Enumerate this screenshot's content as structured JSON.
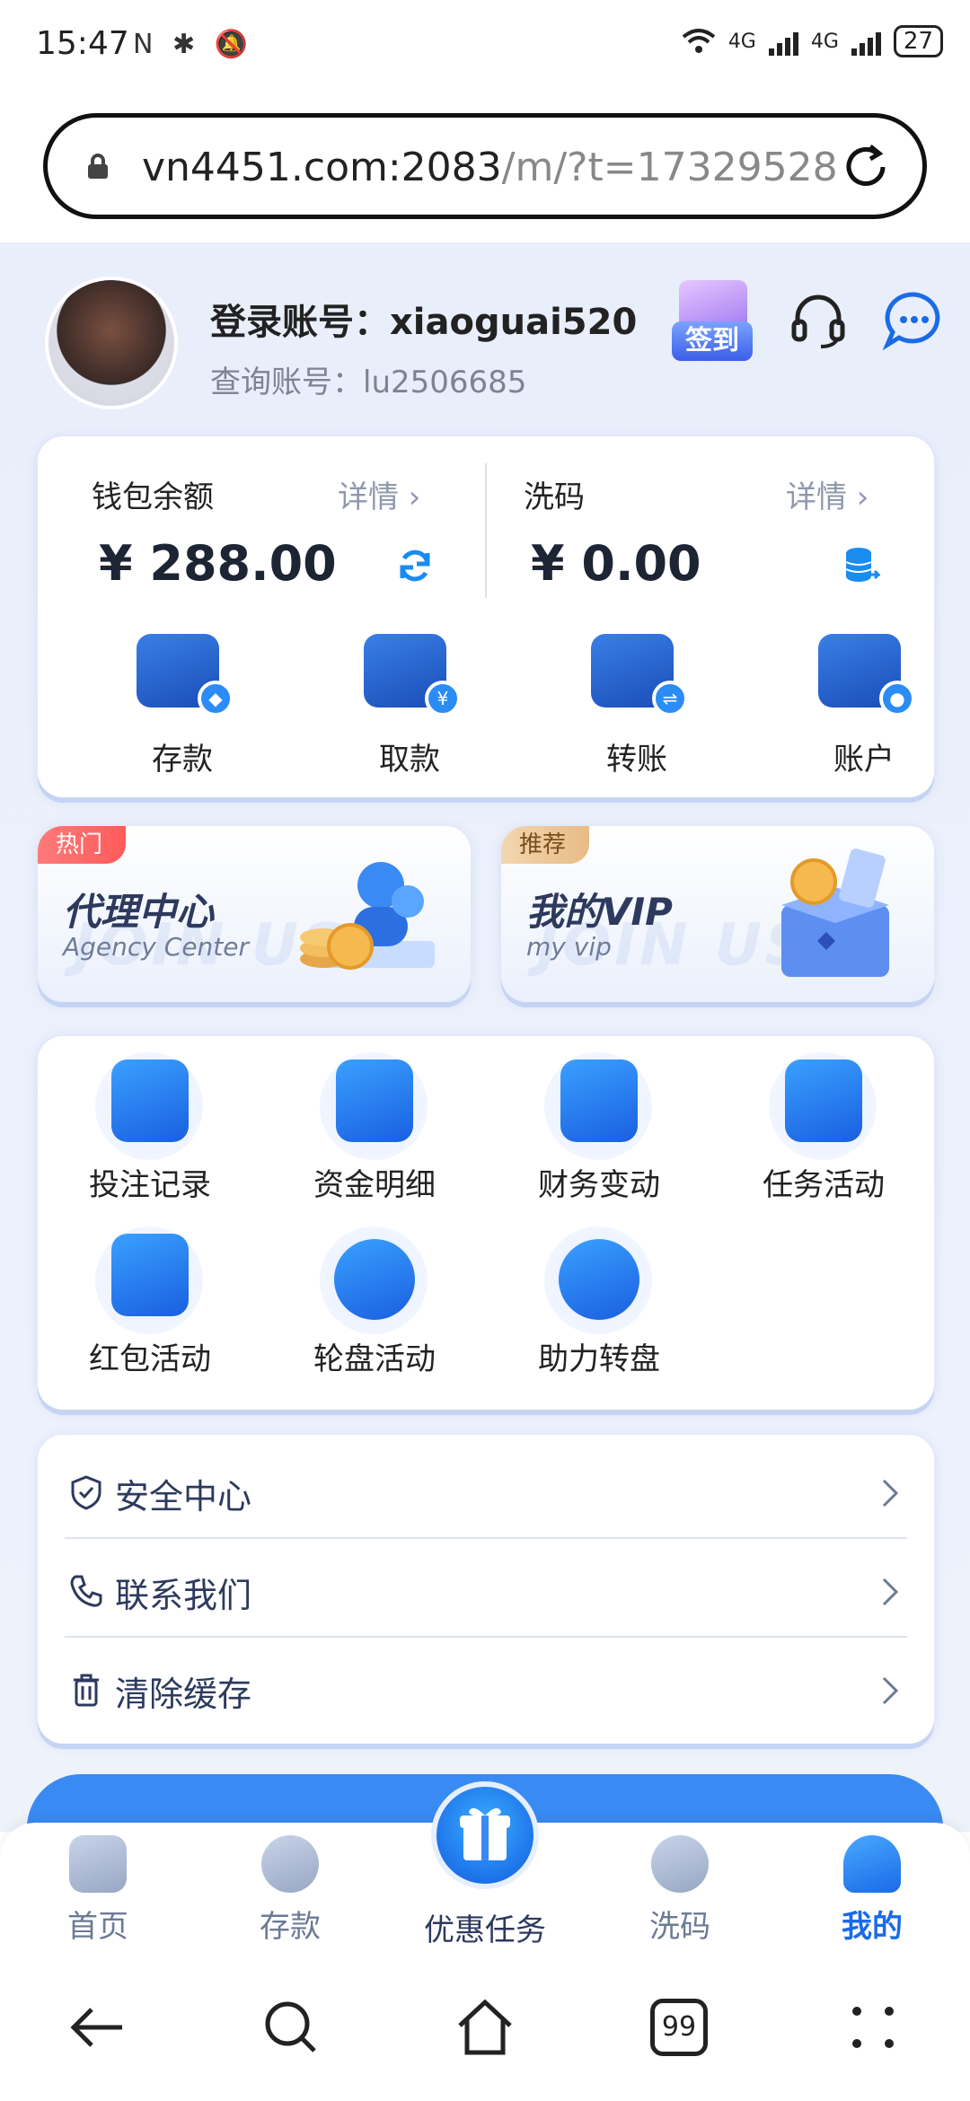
{
  "status_bar": {
    "time": "15:47",
    "left_icons": "N ✱ 🔕",
    "signal_1": "4G",
    "signal_2": "4G",
    "battery": "27"
  },
  "address_bar": {
    "url_host": "vn4451.com:2083",
    "url_path": "/m/?t=17329528"
  },
  "profile": {
    "login_label": "登录账号：xiaoguai520",
    "query_label": "查询账号：lu2506685",
    "signin_label": "签到"
  },
  "wallet": {
    "balance_title": "钱包余额",
    "balance_detail": "详情 ›",
    "balance_amount": "¥ 288.00",
    "wash_title": "洗码",
    "wash_detail": "详情 ›",
    "wash_amount": "¥ 0.00",
    "actions": [
      {
        "label": "存款",
        "badge": "◆"
      },
      {
        "label": "取款",
        "badge": "¥"
      },
      {
        "label": "转账",
        "badge": "⇌"
      },
      {
        "label": "账户",
        "badge": "●"
      }
    ]
  },
  "promos": [
    {
      "tag": "热门",
      "title": "代理中心",
      "subtitle": "Agency Center",
      "watermark": "JOIN US"
    },
    {
      "tag": "推荐",
      "title": "我的VIP",
      "subtitle": "my vip",
      "watermark": "JOIN US"
    }
  ],
  "functions": [
    {
      "label": "投注记录",
      "icon": "spade-book-icon"
    },
    {
      "label": "资金明细",
      "icon": "notebook-icon"
    },
    {
      "label": "财务变动",
      "icon": "chart-up-icon"
    },
    {
      "label": "任务活动",
      "icon": "star-calendar-icon"
    },
    {
      "label": "红包活动",
      "icon": "red-envelope-icon"
    },
    {
      "label": "轮盘活动",
      "icon": "wheel-icon"
    },
    {
      "label": "助力转盘",
      "icon": "prize-wheel-icon"
    }
  ],
  "settings": [
    {
      "label": "安全中心",
      "icon": "shield-icon"
    },
    {
      "label": "联系我们",
      "icon": "phone-icon"
    },
    {
      "label": "清除缓存",
      "icon": "trash-icon"
    }
  ],
  "tabs": [
    {
      "label": "首页",
      "icon": "home-icon"
    },
    {
      "label": "存款",
      "icon": "deposit-icon"
    },
    {
      "label": "优惠任务",
      "icon": "gift-icon"
    },
    {
      "label": "洗码",
      "icon": "wash-icon"
    },
    {
      "label": "我的",
      "icon": "user-icon"
    }
  ],
  "colors": {
    "accent": "#1a6be6",
    "page_bg": "#e9eefb",
    "hot_tag": "#ff5a5a"
  },
  "navbar": {
    "tabs_count": "99"
  }
}
